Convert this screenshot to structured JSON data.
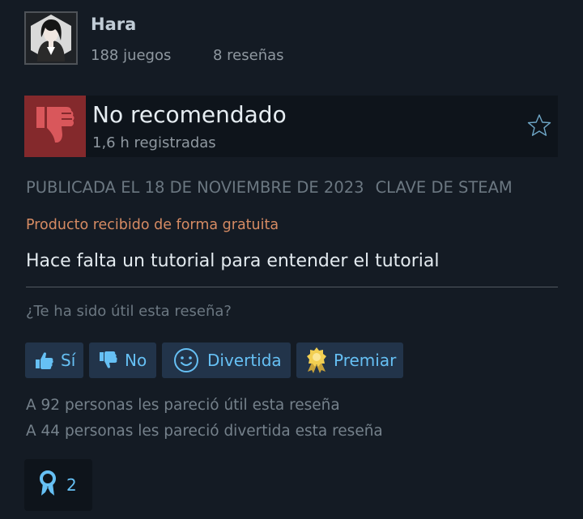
{
  "user": {
    "name": "Hara",
    "games": "188 juegos",
    "reviews": "8 reseñas"
  },
  "recommendation": {
    "title": "No recomendado",
    "hours": "1,6 h registradas"
  },
  "meta": {
    "published": "PUBLICADA EL 18 DE NOVIEMBRE DE 2023",
    "source": "CLAVE DE STEAM",
    "received": "Producto recibido de forma gratuita"
  },
  "review": {
    "text": "Hace falta un tutorial para entender el tutorial"
  },
  "helpful": {
    "question": "¿Te ha sido útil esta reseña?",
    "buttons": {
      "yes": "Sí",
      "no": "No",
      "funny": "Divertida",
      "award": "Premiar"
    },
    "helpful_count": "A 92 personas les pareció útil esta reseña",
    "funny_count": "A 44 personas les pareció divertida esta reseña"
  },
  "awards": {
    "count": "2"
  },
  "icons": {
    "avatar": "avatar",
    "thumb_down_large": "thumbs-down-icon",
    "star": "star-icon",
    "thumb_up": "thumbs-up-icon",
    "thumb_down": "thumbs-down-icon",
    "smile": "smiley-icon",
    "award": "award-icon",
    "award_ribbon": "ribbon-icon"
  },
  "colors": {
    "background": "#141b24",
    "not_recommended": "#84292c",
    "button_bg": "#22344a",
    "accent": "#66c0f4",
    "received": "#d68b63"
  }
}
